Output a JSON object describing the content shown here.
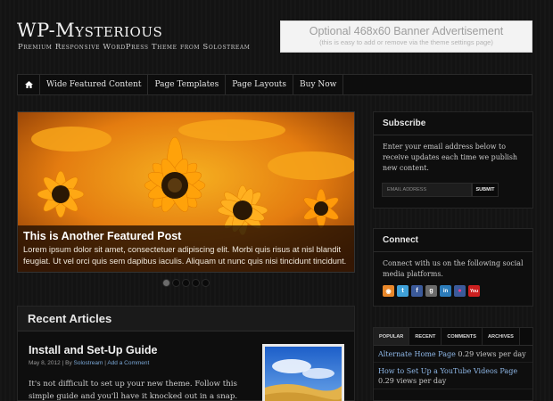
{
  "site": {
    "title": "WP-Mysterious",
    "tagline": "Premium Responsive WordPress Theme from Solostream"
  },
  "banner": {
    "title": "Optional 468x60 Banner Advertisement",
    "subtitle": "(this is easy to add or remove via the theme settings page)"
  },
  "nav": {
    "home_icon": "home-icon",
    "items": [
      {
        "label": "Wide Featured Content"
      },
      {
        "label": "Page Templates"
      },
      {
        "label": "Page Layouts"
      },
      {
        "label": "Buy Now"
      }
    ]
  },
  "featured": {
    "title": "This is Another Featured Post",
    "text": "Lorem ipsum dolor sit amet, consectetuer adipiscing elit. Morbi quis risus at nisl blandit feugiat. Ut vel orci quis sem dapibus iaculis. Aliquam ut nunc quis nisi tincidunt tincidunt.",
    "slide_count": 5,
    "active_slide": 1
  },
  "recent": {
    "heading": "Recent Articles",
    "article": {
      "title": "Install and Set-Up Guide",
      "date": "May 8, 2012",
      "separator": "|",
      "by": "By",
      "author": "Solostream",
      "comment_link": "Add a Comment",
      "excerpt": "It's not difficult to set up your new theme. Follow this simple guide and you'll have it knocked out in a snap."
    }
  },
  "sidebar": {
    "subscribe": {
      "heading": "Subscribe",
      "text": "Enter your email address below to receive updates each time we publish new content.",
      "email_placeholder": "EMAIL ADDRESS",
      "submit_label": "SUBMIT"
    },
    "connect": {
      "heading": "Connect",
      "text": "Connect with us on the following social media platforms.",
      "icons": [
        {
          "name": "rss-icon",
          "glyph": "◉",
          "color": "#e8872a"
        },
        {
          "name": "twitter-icon",
          "glyph": "t",
          "color": "#3fa0d8"
        },
        {
          "name": "facebook-icon",
          "glyph": "f",
          "color": "#3b5a9a"
        },
        {
          "name": "googleplus-icon",
          "glyph": "g",
          "color": "#6b6b6b"
        },
        {
          "name": "linkedin-icon",
          "glyph": "in",
          "color": "#2b7bb9"
        },
        {
          "name": "flickr-icon",
          "glyph": "●",
          "color": "#3b5a9a"
        },
        {
          "name": "youtube-icon",
          "glyph": "You",
          "color": "#cc2020"
        }
      ]
    },
    "tabs": {
      "labels": [
        "POPULAR",
        "RECENT",
        "COMMENTS",
        "ARCHIVES"
      ],
      "active": "POPULAR",
      "popular": [
        {
          "title": "Alternate Home Page",
          "views": "0.29",
          "suffix": "views per day"
        },
        {
          "title": "How to Set Up a YouTube Videos Page",
          "views": "0.29",
          "suffix": "views per day"
        }
      ]
    }
  }
}
